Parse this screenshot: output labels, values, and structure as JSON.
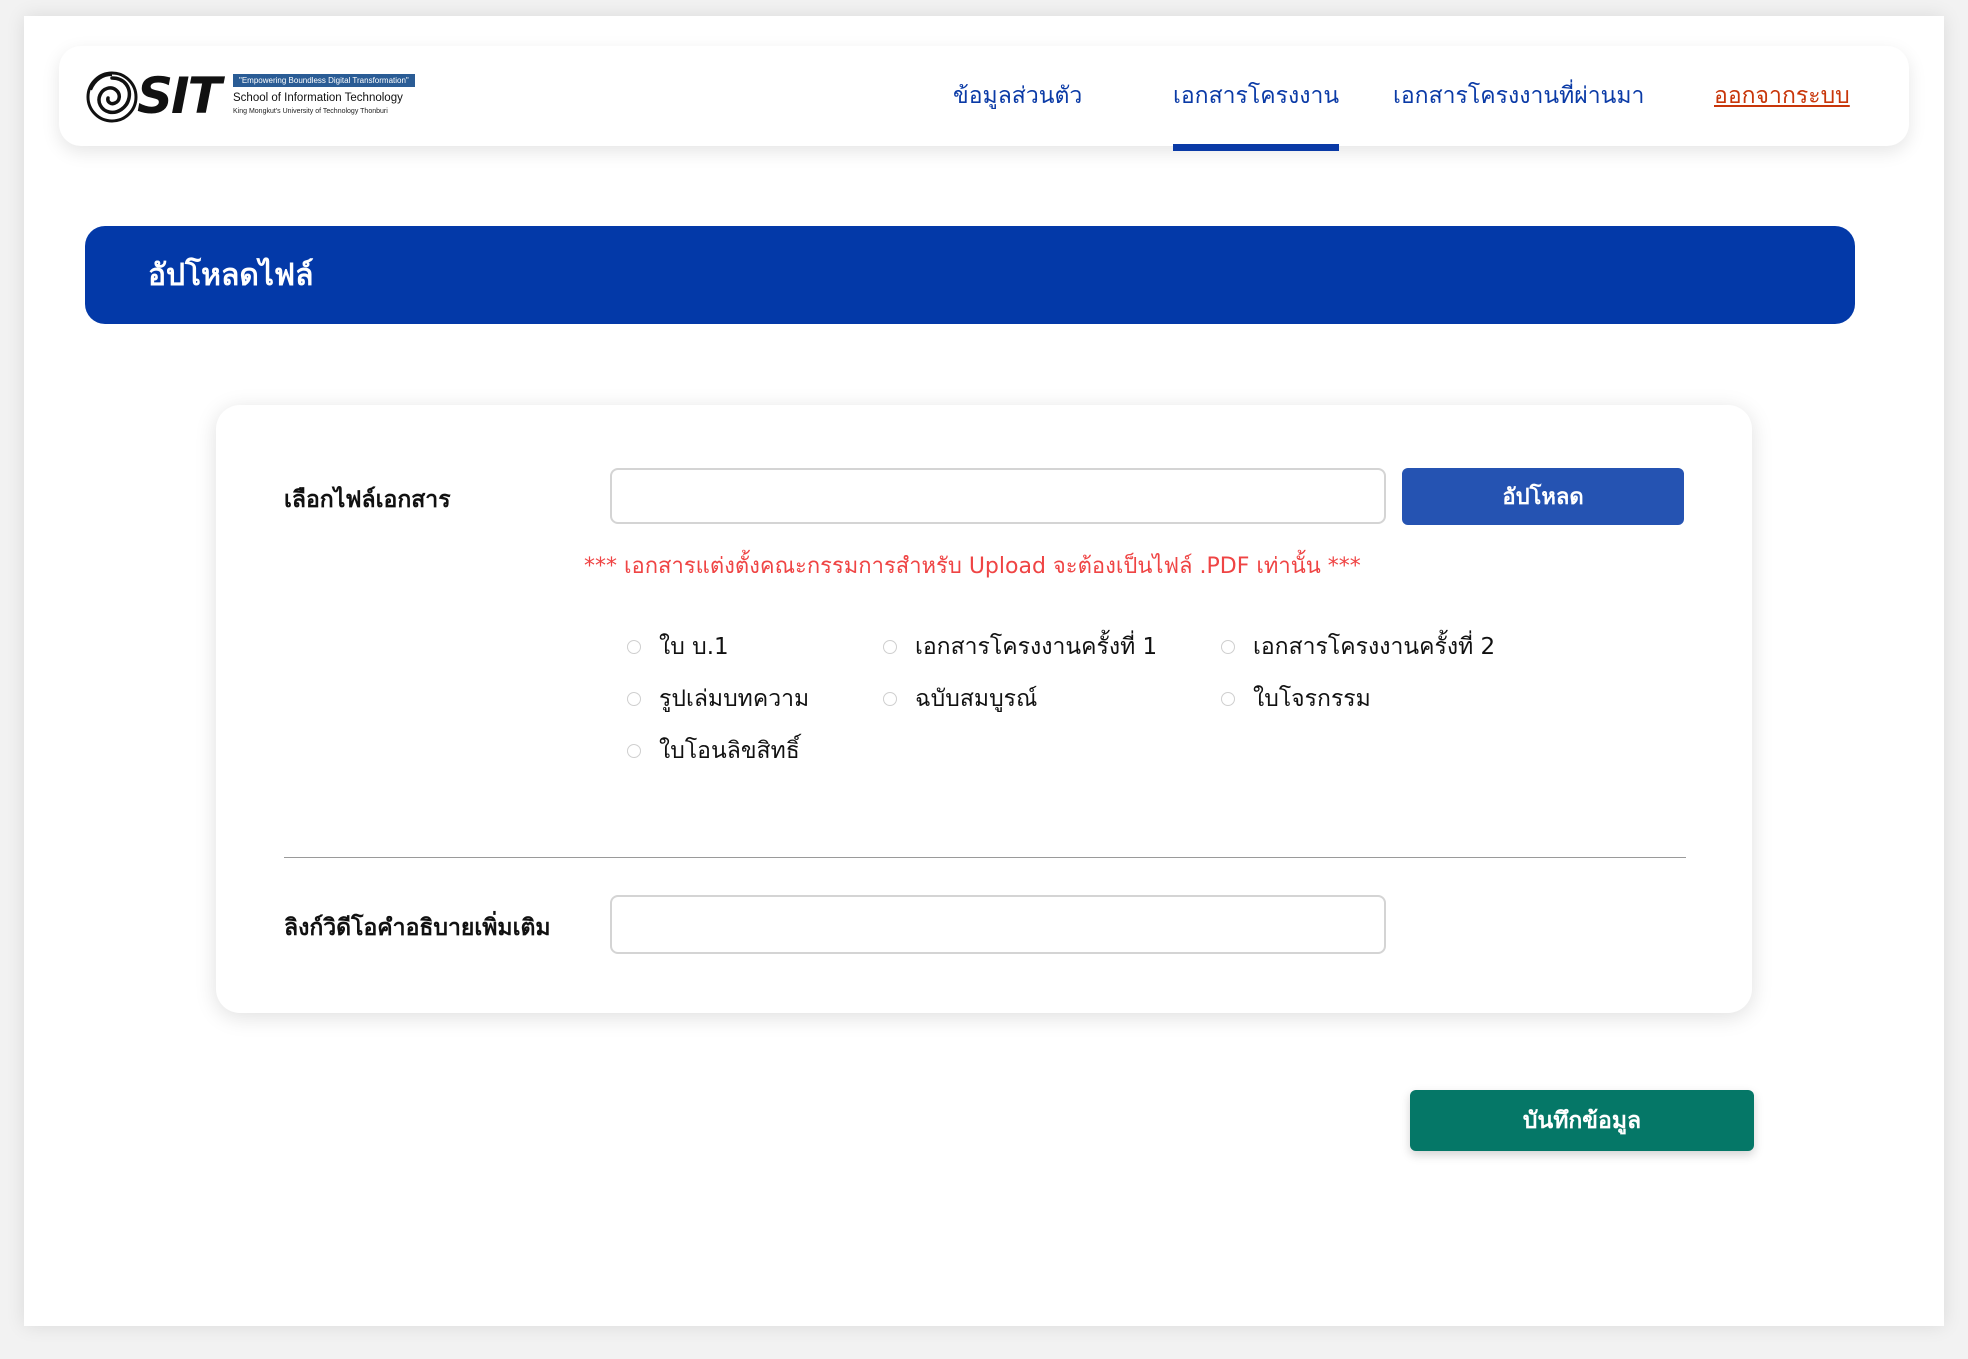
{
  "header": {
    "logo": {
      "brand": "SIT",
      "tagline": "\"Empowering Boundless Digital Transformation\"",
      "school": "School of Information Technology",
      "university": "King Mongkut's University of Technology Thonburi"
    },
    "nav": [
      {
        "label": "ข้อมูลส่วนตัว",
        "active": false
      },
      {
        "label": "เอกสารโครงงาน",
        "active": true
      },
      {
        "label": "เอกสารโครงงานที่ผ่านมา",
        "active": false
      }
    ],
    "logout_label": "ออกจากระบบ",
    "colors": {
      "nav_text": "#0a3aa6",
      "logout": "#c8360a"
    }
  },
  "banner": {
    "title": "อัปโหลดไฟล์",
    "color": "#0339a8"
  },
  "form": {
    "file_label": "เลือกไฟล์เอกสาร",
    "file_value": "",
    "upload_button": "อัปโหลด",
    "warning": "*** เอกสารแต่งตั้งคณะกรรมการสำหรับ Upload จะต้องเป็นไฟล์ .PDF เท่านั้น ***",
    "document_types": [
      {
        "label": "ใบ บ.1",
        "checked": false
      },
      {
        "label": "เอกสารโครงงานครั้งที่ 1",
        "checked": false
      },
      {
        "label": "เอกสารโครงงานครั้งที่ 2",
        "checked": false
      },
      {
        "label": "รูปเล่มบทความ",
        "checked": false
      },
      {
        "label": "ฉบับสมบูรณ์",
        "checked": false
      },
      {
        "label": "ใบโจรกรรม",
        "checked": false
      },
      {
        "label": "ใบโอนลิขสิทธิ์",
        "checked": false
      }
    ],
    "video_label": "ลิงก์วิดีโอคำอธิบายเพิ่มเติม",
    "video_value": ""
  },
  "save_button": "บันทึกข้อมูล",
  "colors": {
    "upload_button": "#2553b2",
    "save_button": "#057767",
    "warning": "#ef4444"
  }
}
